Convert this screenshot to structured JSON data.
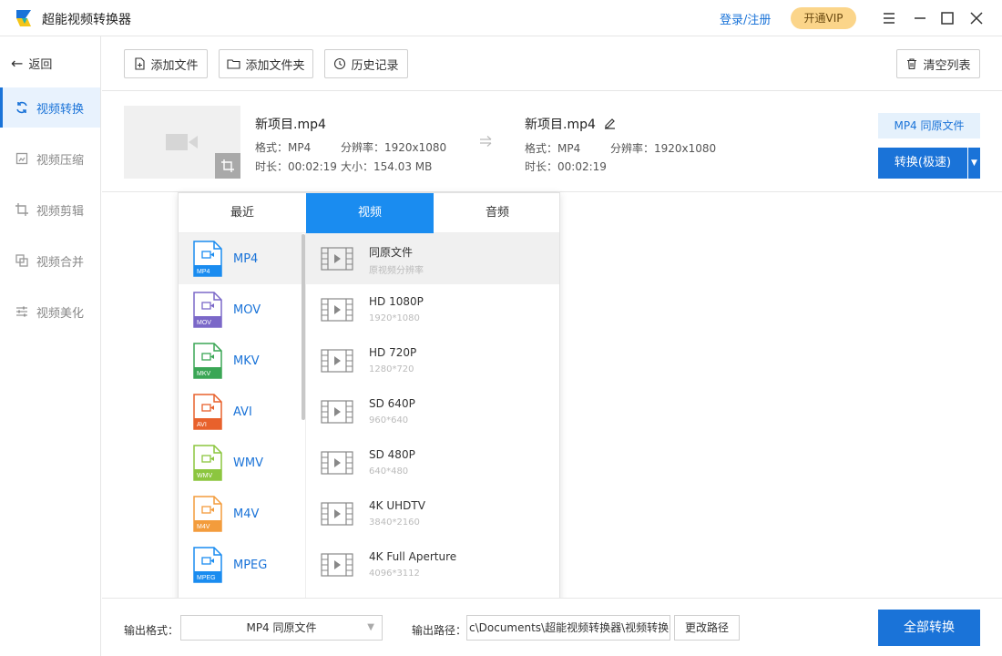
{
  "app": {
    "title": "超能视频转换器",
    "login": "登录/注册",
    "vip": "开通VIP"
  },
  "sidebar": {
    "back": "返回",
    "items": [
      {
        "label": "视频转换",
        "icon": "refresh-icon",
        "active": true
      },
      {
        "label": "视频压缩",
        "icon": "compress-icon",
        "active": false
      },
      {
        "label": "视频剪辑",
        "icon": "crop-icon",
        "active": false
      },
      {
        "label": "视频合并",
        "icon": "merge-icon",
        "active": false
      },
      {
        "label": "视频美化",
        "icon": "sliders-icon",
        "active": false
      }
    ]
  },
  "toolbar": {
    "add_file": "添加文件",
    "add_folder": "添加文件夹",
    "history": "历史记录",
    "clear": "清空列表"
  },
  "file": {
    "src_name": "新项目.mp4",
    "src_format": "格式：MP4",
    "src_resolution": "分辨率：1920x1080",
    "src_duration": "时长：00:02:19",
    "src_size": "大小：154.03 MB",
    "out_name": "新项目.mp4",
    "out_format": "格式：MP4",
    "out_resolution": "分辨率：1920x1080",
    "out_duration": "时长：00:02:19",
    "format_tag": "MP4 同原文件",
    "convert": "转换(极速)"
  },
  "popup": {
    "tabs": [
      "最近",
      "视频",
      "音频"
    ],
    "active_tab": 1,
    "formats": [
      {
        "name": "MP4",
        "color": "#1a8cf0"
      },
      {
        "name": "MOV",
        "color": "#7b68c8"
      },
      {
        "name": "MKV",
        "color": "#3aa655"
      },
      {
        "name": "AVI",
        "color": "#e8612c"
      },
      {
        "name": "WMV",
        "color": "#8cc63f"
      },
      {
        "name": "M4V",
        "color": "#f39c3c"
      },
      {
        "name": "MPEG",
        "color": "#1a8cf0"
      }
    ],
    "resolutions": [
      {
        "name": "同原文件",
        "sub": "原视频分辨率"
      },
      {
        "name": "HD 1080P",
        "sub": "1920*1080"
      },
      {
        "name": "HD 720P",
        "sub": "1280*720"
      },
      {
        "name": "SD 640P",
        "sub": "960*640"
      },
      {
        "name": "SD 480P",
        "sub": "640*480"
      },
      {
        "name": "4K UHDTV",
        "sub": "3840*2160"
      },
      {
        "name": "4K Full Aperture",
        "sub": "4096*3112"
      }
    ]
  },
  "bottom": {
    "format_label": "输出格式：",
    "format_value": "MP4 同原文件",
    "path_label": "输出路径：",
    "path_value": "c\\Documents\\超能视频转换器\\视频转换",
    "change_path": "更改路径",
    "convert_all": "全部转换"
  },
  "colors": {
    "accent": "#1a73d8",
    "tab_active": "#1a8cf0",
    "vip": "#fbd58a"
  }
}
